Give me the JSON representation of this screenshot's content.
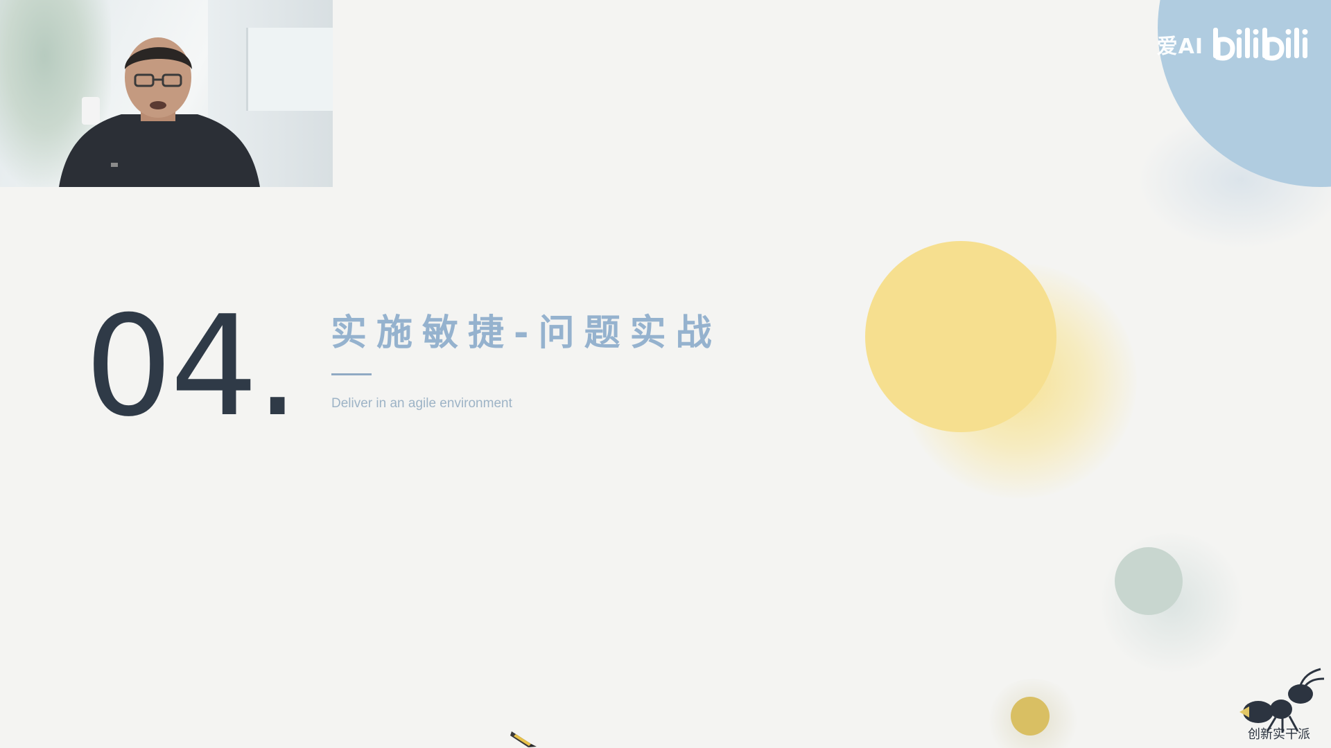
{
  "slide": {
    "section_number": "04",
    "section_dot": ".",
    "title": "实施敏捷-问题实战",
    "subtitle": "Deliver in an agile environment"
  },
  "watermark": {
    "channel": "爱AI",
    "platform": "bilibili"
  },
  "brand": {
    "name": "创新实干派",
    "icon": "ant-icon"
  },
  "cursor": {
    "icon": "pencil-cursor-icon"
  },
  "colors": {
    "background": "#f4f4f2",
    "number": "#2f3a47",
    "title": "#95b2ce",
    "subtitle": "#9db3c6",
    "blue_circle": "#b0cce0",
    "yellow_circle": "#f6df8f",
    "sage_circle": "#c8d6cf",
    "gold_circle": "#d9bf63"
  }
}
